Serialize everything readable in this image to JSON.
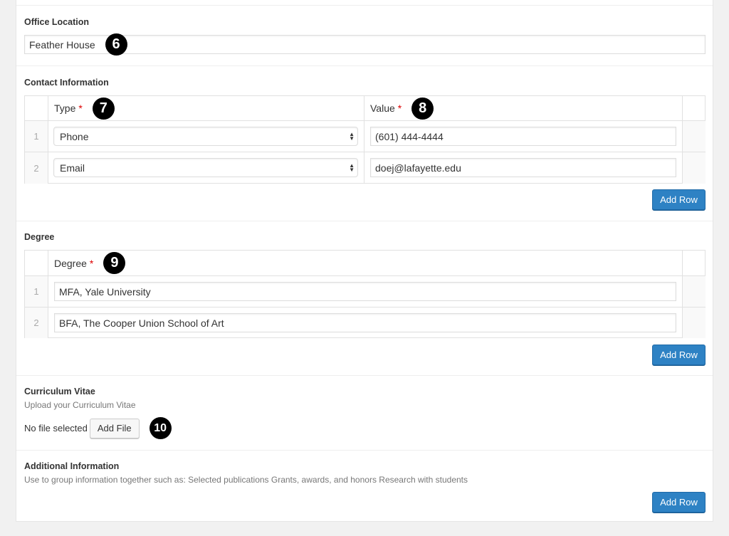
{
  "office": {
    "label": "Office Location",
    "value": "Feather House",
    "badge": "6"
  },
  "contact": {
    "label": "Contact Information",
    "columns": [
      {
        "label": "Type",
        "required": "*",
        "badge": "7"
      },
      {
        "label": "Value",
        "required": "*",
        "badge": "8"
      }
    ],
    "rows": [
      {
        "num": "1",
        "type": "Phone",
        "value": "(601) 444-4444"
      },
      {
        "num": "2",
        "type": "Email",
        "value": "doej@lafayette.edu"
      }
    ],
    "add_row": "Add Row"
  },
  "degree": {
    "label": "Degree",
    "column": {
      "label": "Degree",
      "required": "*",
      "badge": "9"
    },
    "rows": [
      {
        "num": "1",
        "value": "MFA, Yale University"
      },
      {
        "num": "2",
        "value": "BFA, The Cooper Union School of Art"
      }
    ],
    "add_row": "Add Row"
  },
  "cv": {
    "label": "Curriculum Vitae",
    "description": "Upload your Curriculum Vitae",
    "file_status": "No file selected",
    "add_file": "Add File",
    "badge": "10"
  },
  "additional": {
    "label": "Additional Information",
    "description": "Use to group information together such as: Selected publications Grants, awards, and honors Research with students",
    "add_row": "Add Row"
  },
  "colors": {
    "primary_button": "#2e82c4",
    "required": "#dd0000",
    "background": "#f1f1f1"
  }
}
